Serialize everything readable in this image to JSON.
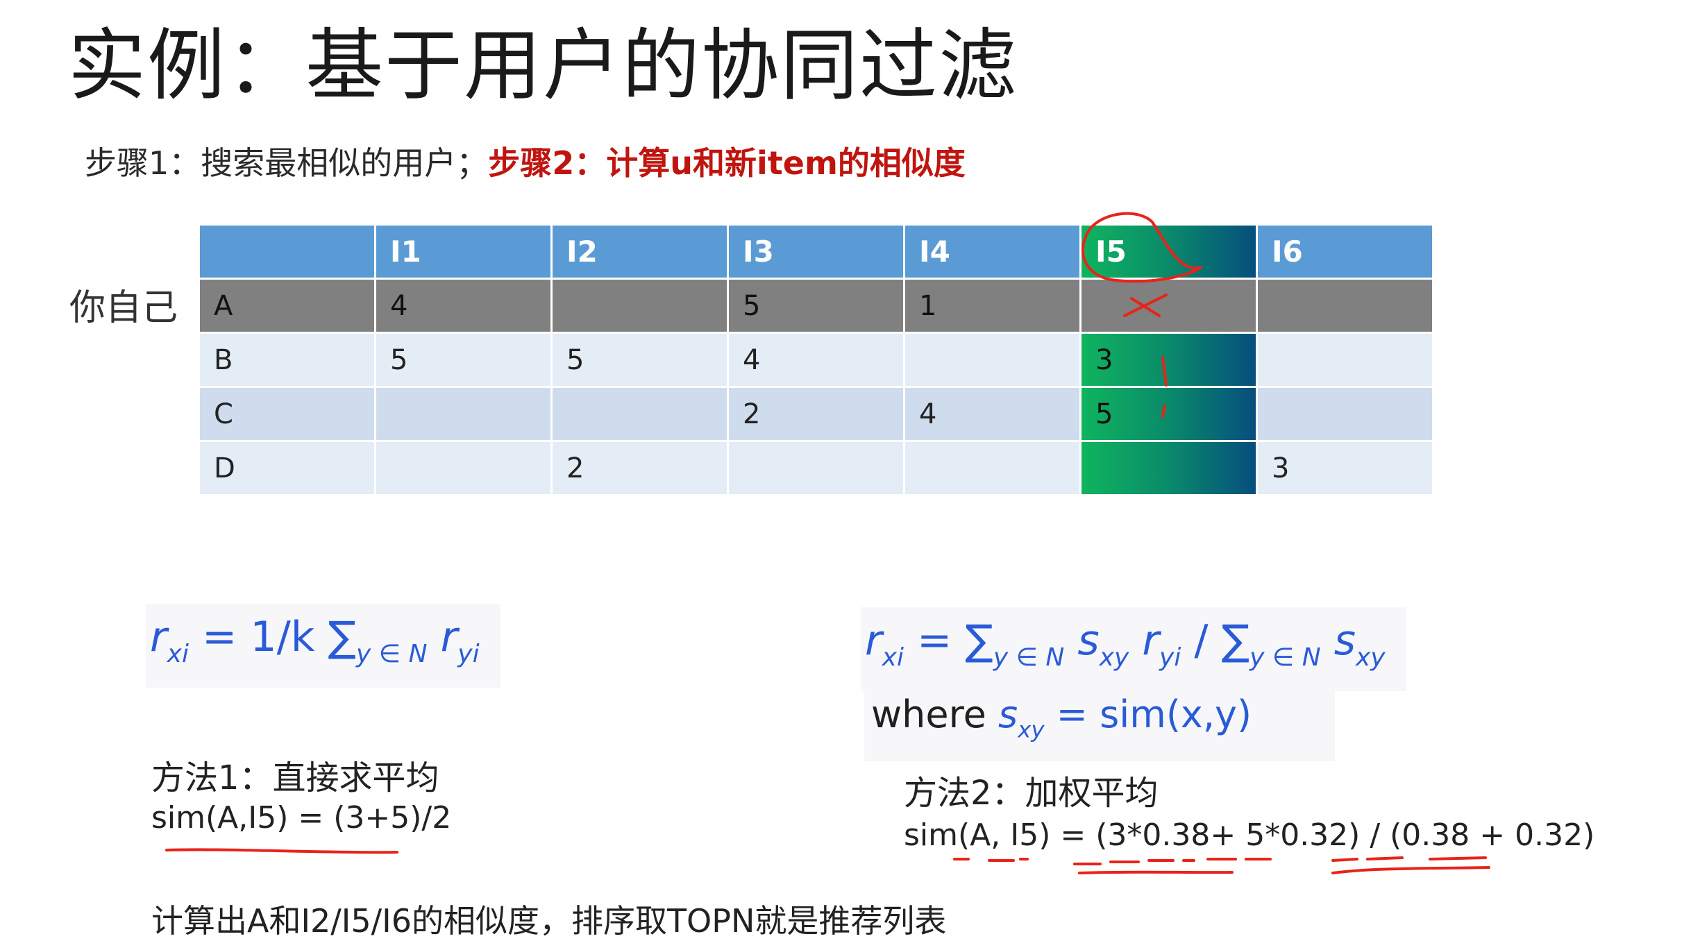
{
  "slide": {
    "title": "实例：基于用户的协同过滤",
    "step1": "步骤1：搜索最相似的用户；",
    "step2": "步骤2：计算u和新item的相似度",
    "self_label": "你自己"
  },
  "table": {
    "headers": [
      "",
      "I1",
      "I2",
      "I3",
      "I4",
      "I5",
      "I6"
    ],
    "rows": [
      [
        "A",
        "4",
        "",
        "5",
        "1",
        "",
        ""
      ],
      [
        "B",
        "5",
        "5",
        "4",
        "",
        "3",
        ""
      ],
      [
        "C",
        "",
        "",
        "2",
        "4",
        "5",
        ""
      ],
      [
        "D",
        "",
        "2",
        "",
        "",
        "",
        "3"
      ]
    ]
  },
  "formulas": {
    "f1": {
      "r": "r",
      "sub_xi": "xi",
      "eq": " = 1/k ",
      "sigma": "∑",
      "sub_sum": "y ∈ N",
      "r2": "r",
      "sub_yi": "yi"
    },
    "f2": {
      "r": "r",
      "sub_xi": "xi",
      "eq": " = ",
      "sigma": "∑",
      "sub_sum": "y ∈ N",
      "s": "s",
      "sub_xy": "xy",
      "r2": "r",
      "sub_yi": "yi",
      "slash": " / ",
      "sigma2": "∑",
      "sub_sum2": "y ∈ N",
      "s2": "s",
      "sub_xy2": "xy"
    },
    "where": {
      "word": "where ",
      "s": "s",
      "sub": "xy",
      "rest": " = sim(x,y)"
    }
  },
  "methods": {
    "m1_title": "方法1：直接求平均",
    "m1_eq": "sim(A,I5) = (3+5)/2",
    "m2_title": "方法2：加权平均",
    "m2_eq": "sim(A, I5) = (3*0.38+ 5*0.32) / (0.38 + 0.32)"
  },
  "conclusion": "计算出A和I2/I5/I6的相似度，排序取TOPN就是推荐列表",
  "colors": {
    "header_blue": "#5b9bd5",
    "row_a_gray": "#808080",
    "highlight_green": "#0fb45e",
    "step2_red": "#c0150f",
    "formula_blue": "#2a5bd7",
    "annotation_red": "#e8231a"
  }
}
